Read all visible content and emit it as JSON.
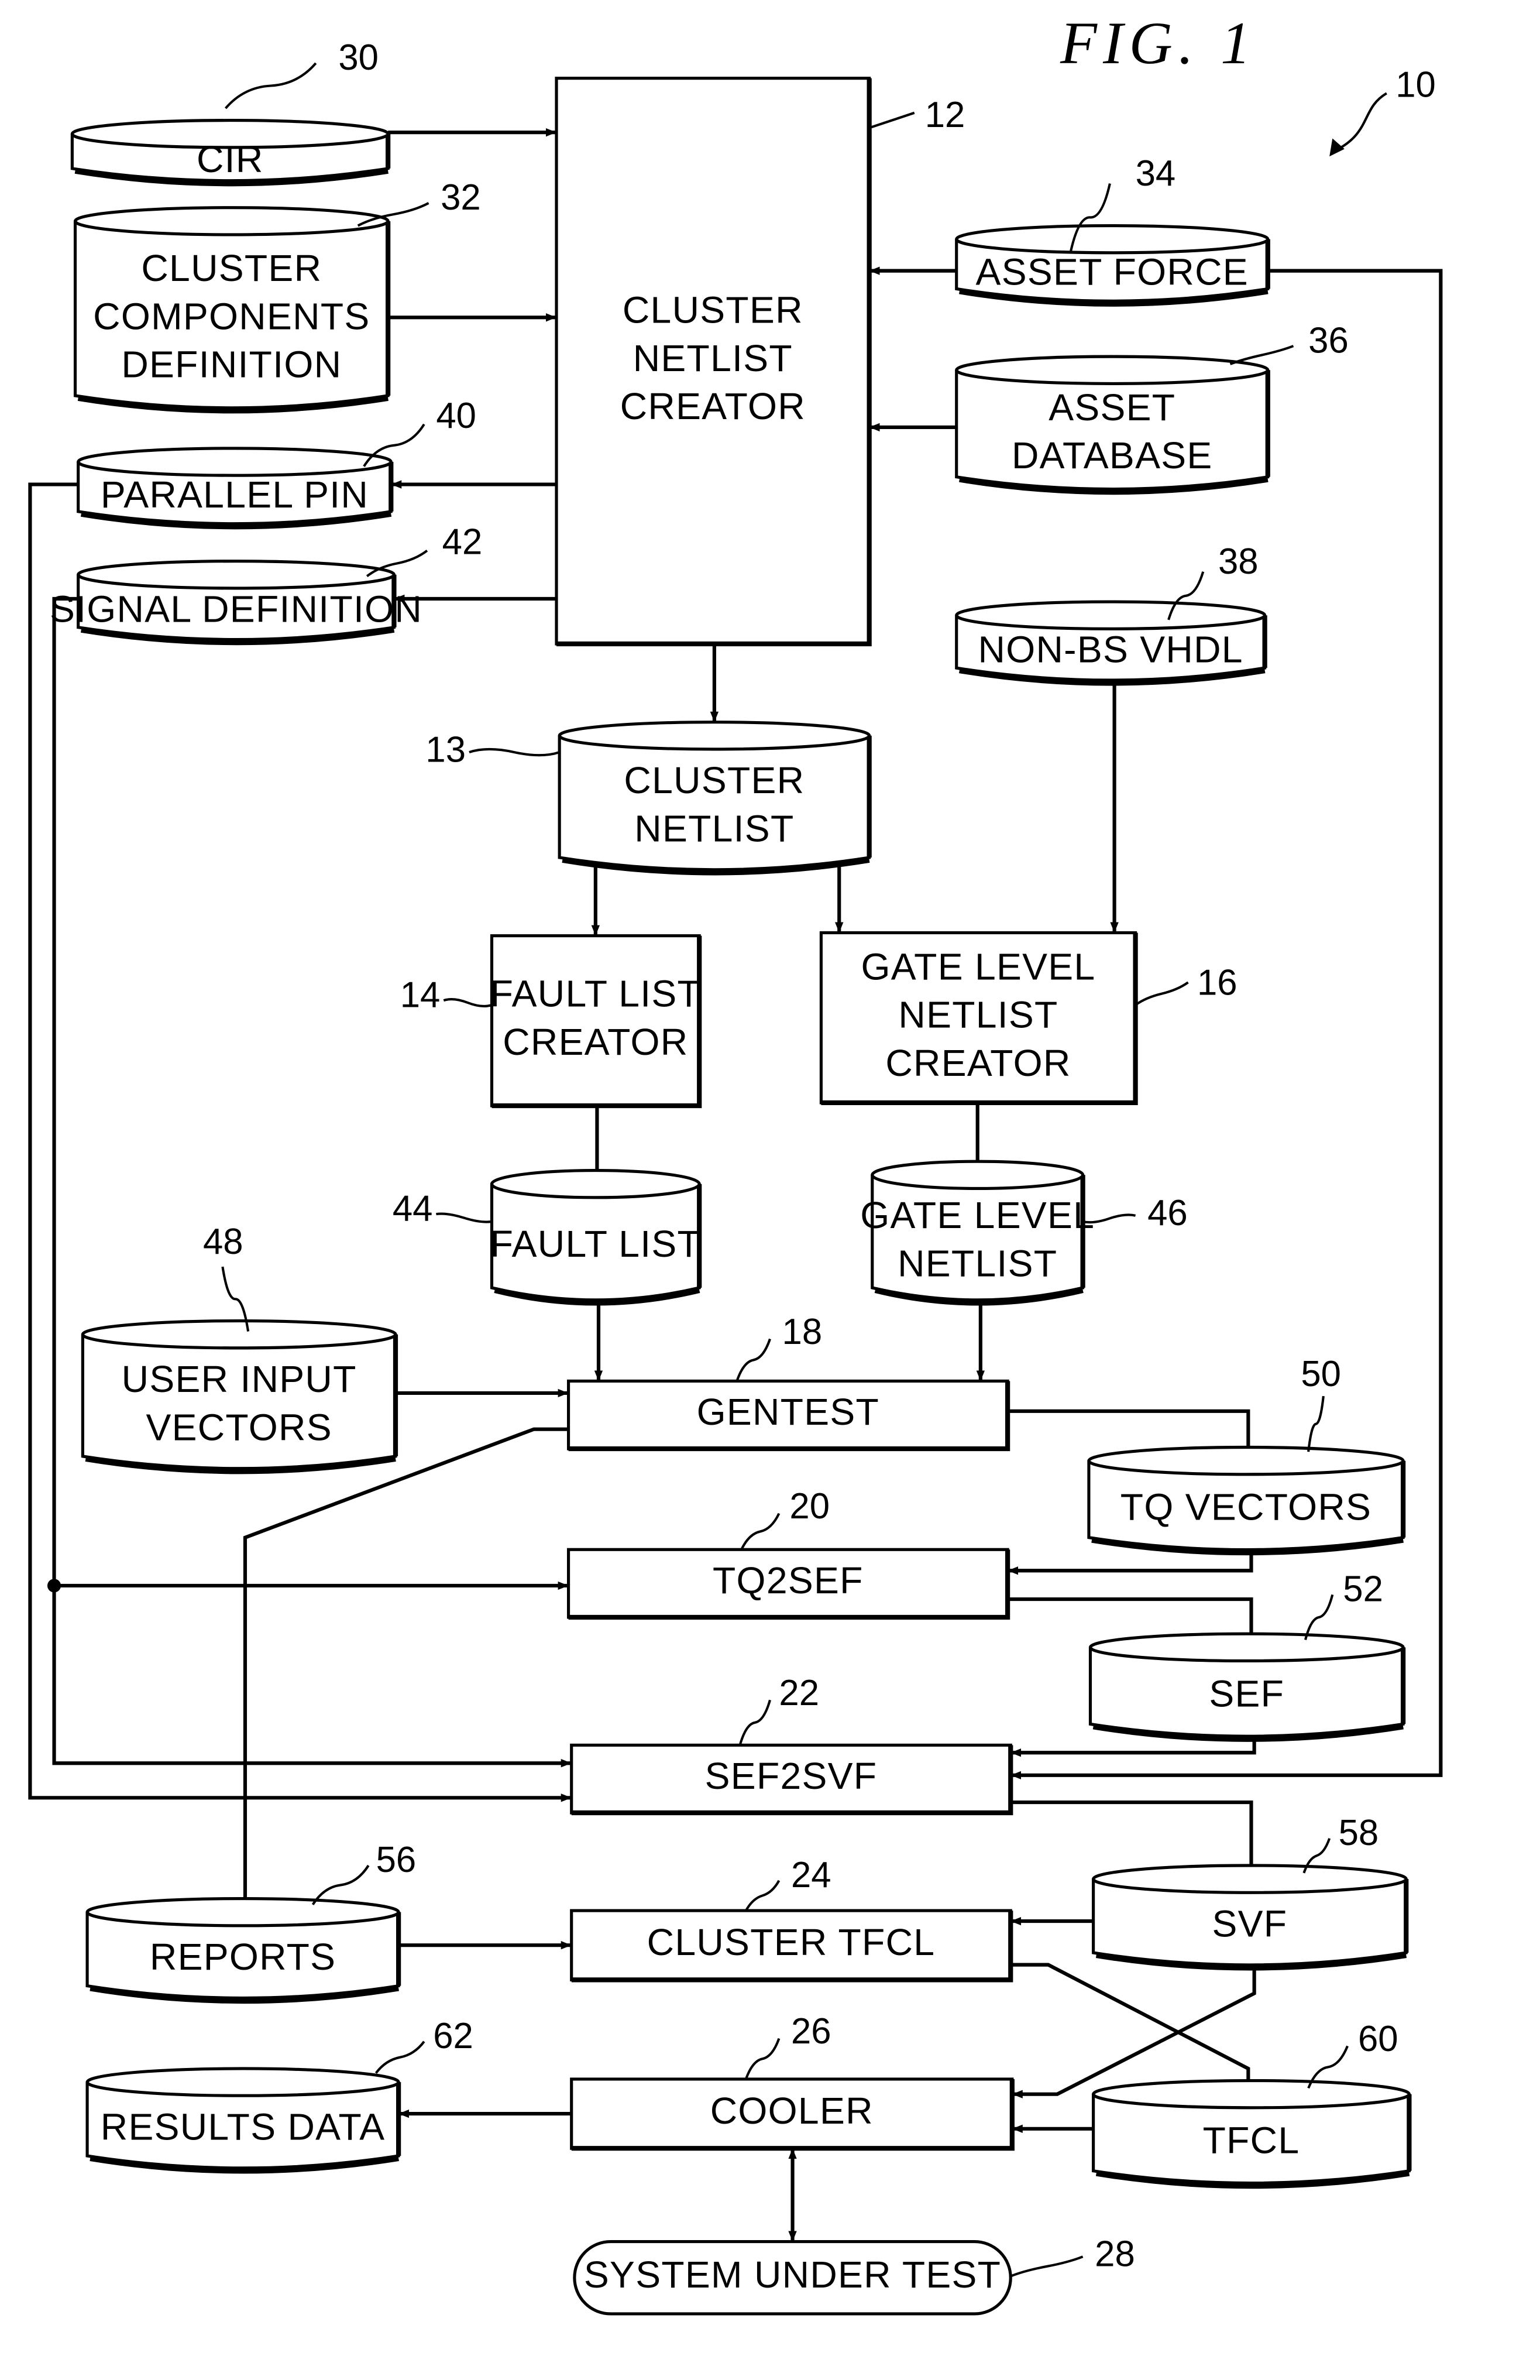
{
  "figure": {
    "title": "FIG.  1",
    "system_ref": "10"
  },
  "nodes": {
    "cir": {
      "label": [
        "CIR"
      ],
      "ref": "30",
      "shape": "database"
    },
    "cluster_components_definition": {
      "label": [
        "CLUSTER",
        "COMPONENTS",
        "DEFINITION"
      ],
      "ref": "32",
      "shape": "database"
    },
    "parallel_pin": {
      "label": [
        "PARALLEL  PIN"
      ],
      "ref": "40",
      "shape": "database"
    },
    "signal_definition": {
      "label": [
        "SIGNAL  DEFINITION"
      ],
      "ref": "42",
      "shape": "database"
    },
    "cluster_netlist_creator": {
      "label": [
        "CLUSTER",
        "NETLIST",
        "CREATOR"
      ],
      "ref": "12",
      "shape": "process"
    },
    "asset_force": {
      "label": [
        "ASSET  FORCE"
      ],
      "ref": "34",
      "shape": "database"
    },
    "asset_database": {
      "label": [
        "ASSET",
        "DATABASE"
      ],
      "ref": "36",
      "shape": "database"
    },
    "non_bs_vhdl": {
      "label": [
        "NON-BS  VHDL"
      ],
      "ref": "38",
      "shape": "database"
    },
    "cluster_netlist": {
      "label": [
        "CLUSTER",
        "NETLIST"
      ],
      "ref": "13",
      "shape": "database"
    },
    "fault_list_creator": {
      "label": [
        "FAULT  LIST",
        "CREATOR"
      ],
      "ref": "14",
      "shape": "process"
    },
    "gate_level_netlist_creator": {
      "label": [
        "GATE  LEVEL",
        "NETLIST",
        "CREATOR"
      ],
      "ref": "16",
      "shape": "process"
    },
    "fault_list": {
      "label": [
        "FAULT  LIST"
      ],
      "ref": "44",
      "shape": "database"
    },
    "gate_level_netlist": {
      "label": [
        "GATE  LEVEL",
        "NETLIST"
      ],
      "ref": "46",
      "shape": "database"
    },
    "user_input_vectors": {
      "label": [
        "USER  INPUT",
        "VECTORS"
      ],
      "ref": "48",
      "shape": "database"
    },
    "gentest": {
      "label": [
        "GENTEST"
      ],
      "ref": "18",
      "shape": "process"
    },
    "tq_vectors": {
      "label": [
        "TQ  VECTORS"
      ],
      "ref": "50",
      "shape": "database"
    },
    "tq2sef": {
      "label": [
        "TQ2SEF"
      ],
      "ref": "20",
      "shape": "process"
    },
    "sef": {
      "label": [
        "SEF"
      ],
      "ref": "52",
      "shape": "database"
    },
    "sef2svf": {
      "label": [
        "SEF2SVF"
      ],
      "ref": "22",
      "shape": "process"
    },
    "reports": {
      "label": [
        "REPORTS"
      ],
      "ref": "56",
      "shape": "database"
    },
    "cluster_tfcl": {
      "label": [
        "CLUSTER  TFCL"
      ],
      "ref": "24",
      "shape": "process"
    },
    "svf": {
      "label": [
        "SVF"
      ],
      "ref": "58",
      "shape": "database"
    },
    "results_data": {
      "label": [
        "RESULTS  DATA"
      ],
      "ref": "62",
      "shape": "database"
    },
    "cooler": {
      "label": [
        "COOLER"
      ],
      "ref": "26",
      "shape": "process"
    },
    "tfcl": {
      "label": [
        "TFCL"
      ],
      "ref": "60",
      "shape": "database"
    },
    "system_under_test": {
      "label": [
        "SYSTEM  UNDER  TEST"
      ],
      "ref": "28",
      "shape": "terminal"
    }
  },
  "edges": [
    {
      "from": "cir",
      "to": "cluster_netlist_creator"
    },
    {
      "from": "cluster_components_definition",
      "to": "cluster_netlist_creator"
    },
    {
      "from": "cluster_netlist_creator",
      "to": "parallel_pin"
    },
    {
      "from": "cluster_netlist_creator",
      "to": "signal_definition"
    },
    {
      "from": "asset_force",
      "to": "cluster_netlist_creator"
    },
    {
      "from": "asset_force",
      "to": "sef2svf"
    },
    {
      "from": "asset_database",
      "to": "cluster_netlist_creator"
    },
    {
      "from": "cluster_netlist_creator",
      "to": "cluster_netlist"
    },
    {
      "from": "cluster_netlist",
      "to": "fault_list_creator"
    },
    {
      "from": "cluster_netlist",
      "to": "gate_level_netlist_creator"
    },
    {
      "from": "non_bs_vhdl",
      "to": "gate_level_netlist_creator"
    },
    {
      "from": "fault_list_creator",
      "to": "fault_list"
    },
    {
      "from": "gate_level_netlist_creator",
      "to": "gate_level_netlist"
    },
    {
      "from": "fault_list",
      "to": "gentest"
    },
    {
      "from": "gate_level_netlist",
      "to": "gentest"
    },
    {
      "from": "user_input_vectors",
      "to": "gentest"
    },
    {
      "from": "gentest",
      "to": "tq_vectors"
    },
    {
      "from": "gentest",
      "to": "reports"
    },
    {
      "from": "signal_definition",
      "to": "tq2sef"
    },
    {
      "from": "tq_vectors",
      "to": "tq2sef"
    },
    {
      "from": "tq2sef",
      "to": "sef"
    },
    {
      "from": "signal_definition",
      "to": "sef2svf"
    },
    {
      "from": "parallel_pin",
      "to": "sef2svf"
    },
    {
      "from": "sef",
      "to": "sef2svf"
    },
    {
      "from": "sef2svf",
      "to": "svf"
    },
    {
      "from": "reports",
      "to": "cluster_tfcl"
    },
    {
      "from": "svf",
      "to": "cluster_tfcl"
    },
    {
      "from": "cluster_tfcl",
      "to": "tfcl"
    },
    {
      "from": "svf",
      "to": "cooler"
    },
    {
      "from": "tfcl",
      "to": "cooler"
    },
    {
      "from": "cooler",
      "to": "results_data"
    },
    {
      "from": "cooler",
      "to": "system_under_test",
      "bidirectional": true
    }
  ]
}
